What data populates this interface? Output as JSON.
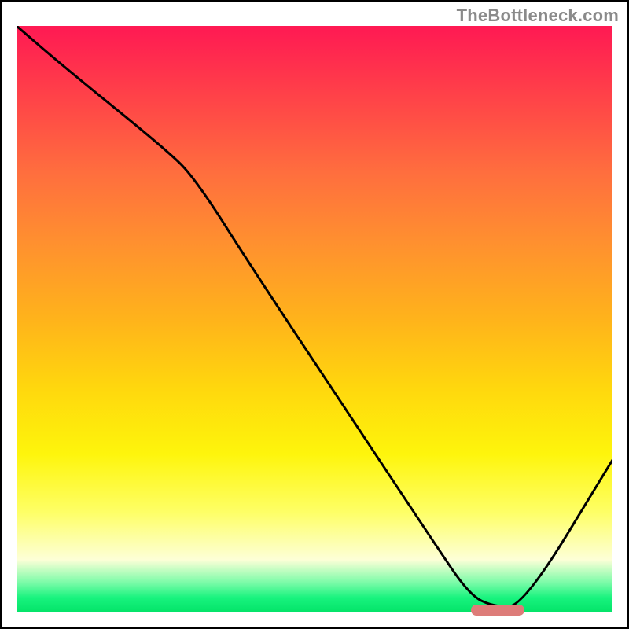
{
  "watermark": "TheBottleneck.com",
  "colors": {
    "top": "#ff1953",
    "mid": "#ffd80d",
    "bottom": "#03e368",
    "marker": "#dd7c79",
    "curve": "#000000"
  },
  "chart_data": {
    "type": "line",
    "title": "",
    "xlabel": "",
    "ylabel": "",
    "xlim": [
      0,
      100
    ],
    "ylim": [
      0,
      100
    ],
    "x": [
      0,
      8,
      25,
      30,
      40,
      55,
      70,
      76,
      80,
      85,
      100
    ],
    "values": [
      100,
      93,
      79,
      74,
      58,
      35,
      12,
      3,
      1,
      1,
      26
    ],
    "marker_range_x": [
      76,
      85
    ],
    "marker_y": 1,
    "notes": "y is a normalized bottleneck/mismatch score (0 best, 100 worst); x is a normalized configuration axis. Values estimated from pixel positions; chart has no numeric tick labels."
  }
}
